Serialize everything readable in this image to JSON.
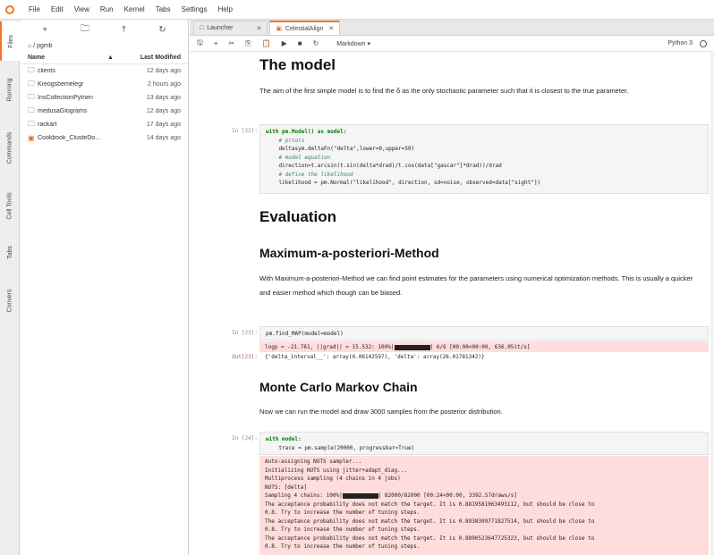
{
  "menu": [
    "File",
    "Edit",
    "View",
    "Run",
    "Kernel",
    "Tabs",
    "Settings",
    "Help"
  ],
  "side_tabs": [
    "Files",
    "Running",
    "Commands",
    "Cell Tools",
    "Tabs",
    "Convers"
  ],
  "filebrowser": {
    "path": "⌂ / pgmb",
    "col_name": "Name",
    "col_sort": "▲",
    "col_modified": "Last Modified",
    "files": [
      {
        "name": "clients",
        "date": "12 days ago",
        "type": "folder"
      },
      {
        "name": "Kreogsbemelegr",
        "date": "2 hours ago",
        "type": "folder"
      },
      {
        "name": "InsCollectionPytnen",
        "date": "13 days ago",
        "type": "folder"
      },
      {
        "name": "medusaGlograms",
        "date": "12 days ago",
        "type": "folder"
      },
      {
        "name": "rackart",
        "date": "17 days ago",
        "type": "folder"
      },
      {
        "name": "Cookbook_ClusteDo...",
        "date": "14 days ago",
        "type": "notebook"
      }
    ]
  },
  "tabs": [
    {
      "label": "Launcher",
      "active": false
    },
    {
      "label": "CelestialAlign",
      "active": true
    }
  ],
  "toolbar": {
    "cell_type": "Markdown ▾",
    "kernel": "Python 3"
  },
  "cells": {
    "model_heading": "The model",
    "model_text": "The aim of the first simple model is to find the δ as the only stochastic parameter such that it is closest to the true parameter.",
    "cell1_prompt": "In [22]:",
    "cell1_lines": [
      "with pm.Model() as model:",
      "    # priors",
      "    deltasym.deltaFn(\"delta\",lower=0,upper=50)",
      "    # model equation",
      "    direction=t.arcsin(t.sin(delta*drad)/t.cos(data[\"gascar\"]*drad))/drad",
      "    # define the likelihood",
      "    likelihood = pm.Normal(\"likelihood\", direction, sd=noise, observed=data[\"sight\"])"
    ],
    "eval_heading": "Evaluation",
    "map_heading": "Maximum-a-posteriori-Method",
    "map_text": "With Maximum-a-posteriori-Method we can find point estimates for the parameters using numerical optimization methods. This is usually a quicker and easier method which though can be biased.",
    "cell2_prompt": "In [23]:",
    "cell2_code": "pm.find_MAP(model=model)",
    "cell2_stderr_pre": "logp = -21.761, ||grad|| = 15.532: 100%|",
    "cell2_stderr_post": "| 6/6 [00:00<00:00, 636.05it/s]",
    "cell2_out_prompt": "Out[23]:",
    "cell2_out": "{'delta_interval__': array(0.06142597), 'delta': array(26.01781342)}",
    "mcmc_heading": "Monte Carlo Markov Chain",
    "mcmc_text": "Now we can run the model and draw 3000 samples from the posterior distribution.",
    "cell3_prompt": "In [24]:",
    "cell3_lines": [
      "with model:",
      "    trace = pm.sample(20000, progressbar=True)"
    ],
    "cell3_stderr": [
      "Auto-assigning NUTS sampler...",
      "Initializing NUTS using jitter+adapt_diag...",
      "Multiprocess sampling (4 chains in 4 jobs)",
      "NUTS: [delta]",
      "",
      "The acceptance probability does not match the target. It is 0.8819581063493112, but should be close to",
      "0.8. Try to increase the number of tuning steps.",
      "The acceptance probability does not match the target. It is 0.8938309771827514, but should be close to",
      "0.8. Try to increase the number of tuning steps.",
      "The acceptance probability does not match the target. It is 0.8890523647725323, but should be close to",
      "0.8. Try to increase the number of tuning steps."
    ],
    "cell3_sampling_pre": "Sampling 4 chains: 100%|",
    "cell3_sampling_post": "| 82000/82000 [00:24<00:00, 3392.57draws/s]"
  }
}
